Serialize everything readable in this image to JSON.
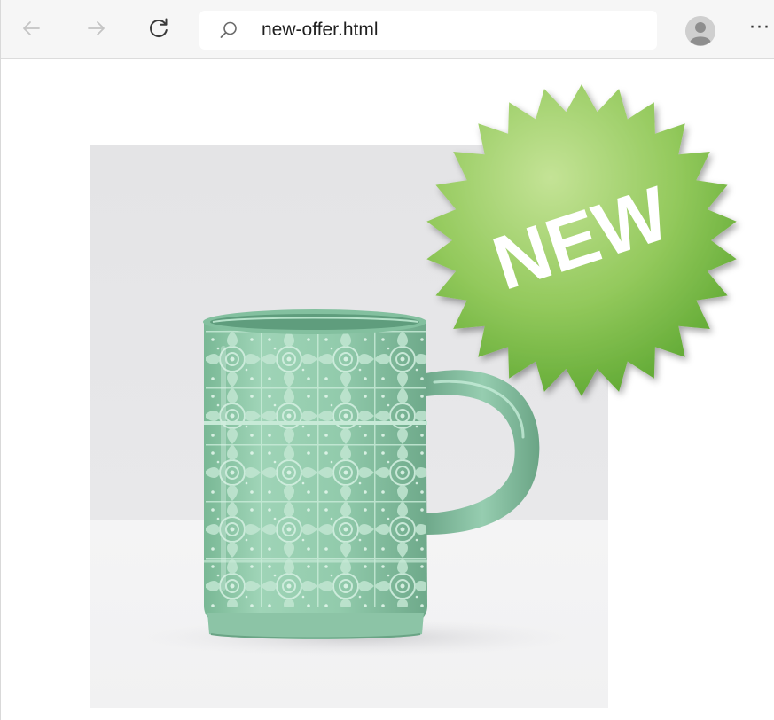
{
  "browser": {
    "nav": {
      "back_icon": "arrow-left-icon",
      "forward_icon": "arrow-right-icon",
      "reload_icon": "reload-icon"
    },
    "address": {
      "icon": "search-icon",
      "value": "new-offer.html"
    },
    "profile_icon": "avatar-icon",
    "more_label": "···"
  },
  "page": {
    "badge_text": "NEW",
    "colors": {
      "badge_green": "#8cc655",
      "mug_green": "#8fc9ab",
      "backdrop_gray": "#e6e6e8"
    }
  }
}
